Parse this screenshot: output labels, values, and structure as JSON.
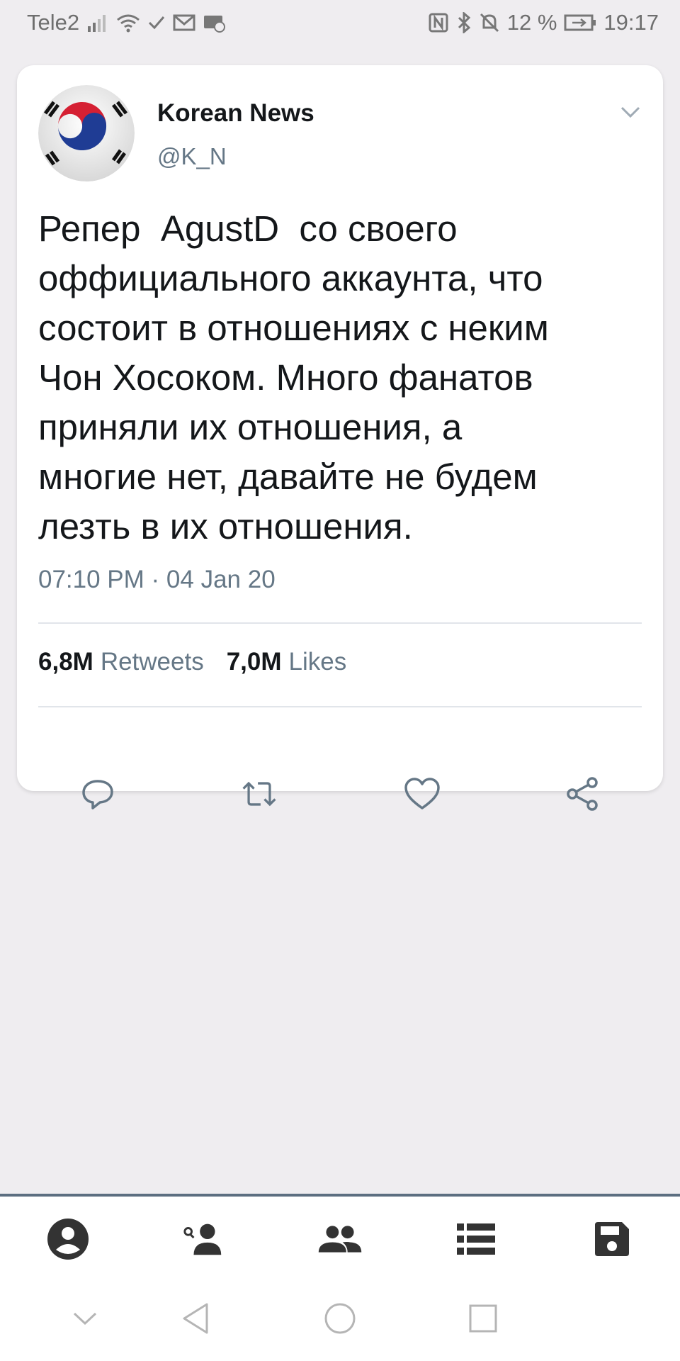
{
  "status_bar": {
    "carrier": "Tele2",
    "battery_percent": "12 %",
    "time": "19:17",
    "icons_left": [
      "signal-icon",
      "wifi-icon",
      "check-icon",
      "gmail-icon",
      "mail-icon"
    ],
    "icons_right": [
      "nfc-icon",
      "bluetooth-icon",
      "bell-off-icon",
      "battery-icon"
    ]
  },
  "tweet": {
    "author_name": "Korean News",
    "author_handle": "@K_N",
    "text": "Репер  AgustD  со своего\nоффициального аккаунта, что\nсостоит в отношениях с неким\nЧон Хосоком. Много фанатов\nприняли их отношения, а\nмногие нет, давайте не будем\nлезть в их отношения.",
    "timestamp": "07:10 PM · 04 Jan 20",
    "retweets_count": "6,8M",
    "retweets_label": "Retweets",
    "likes_count": "7,0M",
    "likes_label": "Likes",
    "actions": [
      "reply-icon",
      "retweet-icon",
      "like-icon",
      "share-icon"
    ]
  },
  "bottom_tabs": [
    "profile-icon",
    "add-person-icon",
    "people-icon",
    "list-icon",
    "save-icon"
  ],
  "system_nav": [
    "collapse-icon",
    "back-icon",
    "home-icon",
    "recents-icon"
  ],
  "colors": {
    "background": "#efedf0",
    "card": "#ffffff",
    "text": "#14171a",
    "secondary_text": "#657786",
    "icon": "#657786",
    "tab_icon": "#333333",
    "bottom_bar_border": "#5c6e80"
  }
}
